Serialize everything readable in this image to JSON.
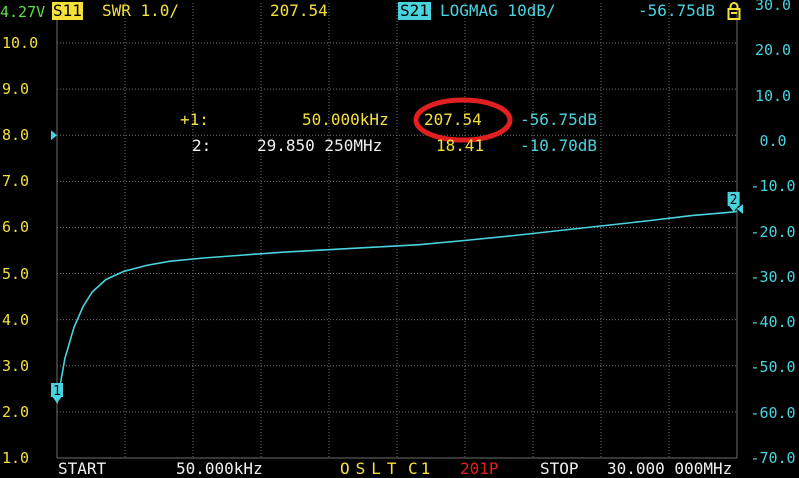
{
  "header": {
    "battery": "4.27V",
    "ch1_label": "S11",
    "ch1_format": "SWR 1.0/",
    "ch1_value": "207.54",
    "ch2_label": "S21",
    "ch2_format": "LOGMAG 10dB/",
    "ch2_value": "-56.75dB"
  },
  "markers": [
    {
      "label": "+1:",
      "freq": "50.000kHz",
      "swr": "207.54",
      "db": "-56.75dB"
    },
    {
      "label": "2:",
      "freq": "29.850 250MHz",
      "swr": "18.41",
      "db": "-10.70dB"
    }
  ],
  "footer": {
    "start_label": "START",
    "start_freq": "50.000kHz",
    "cal": "OSLT",
    "cal_slot": "C1",
    "points": "201P",
    "stop_label": "STOP",
    "stop_freq": "30.000 000MHz"
  },
  "colors": {
    "swr_axis": "#f5e03a",
    "logmag_axis": "#49d3df",
    "grid": "#6e6e6e",
    "annotation": "#e02020"
  },
  "chart_data": {
    "type": "line",
    "x_range_mhz": [
      0.05,
      30.0
    ],
    "y_left": {
      "label": "SWR",
      "range": [
        1.0,
        10.0
      ],
      "ticks": [
        "10.0",
        "9.0",
        "8.0",
        "7.0",
        "6.0",
        "5.0",
        "4.0",
        "3.0",
        "2.0",
        "1.0"
      ]
    },
    "y_right": {
      "label": "S21 LOGMAG",
      "range": [
        -70,
        30
      ],
      "ticks": [
        "30.0",
        "20.0",
        "10.0",
        "0.0",
        "-10.0",
        "-20.0",
        "-30.0",
        "-40.0",
        "-50.0",
        "-60.0",
        "-70.0"
      ]
    },
    "grid": true,
    "series": [
      {
        "axis": "right",
        "x": [
          0.05,
          0.4,
          0.8,
          1.2,
          1.6,
          2.2,
          3.0,
          4.0,
          5.0,
          6.5,
          8.0,
          10.0,
          12.0,
          14.0,
          16.0,
          18.0,
          20.0,
          22.0,
          24.0,
          26.0,
          28.0,
          29.85,
          30.0
        ],
        "y": [
          -56.75,
          -46.0,
          -38.5,
          -33.5,
          -30.0,
          -27.0,
          -25.0,
          -23.6,
          -22.6,
          -21.8,
          -21.2,
          -20.4,
          -19.8,
          -19.2,
          -18.6,
          -17.6,
          -16.5,
          -15.3,
          -14.1,
          -12.9,
          -11.6,
          -10.7,
          -10.55
        ]
      }
    ],
    "marker_points": [
      {
        "label": "1",
        "x": 0.05,
        "y": -56.75
      },
      {
        "label": "2",
        "x": 29.85,
        "y": -10.7
      }
    ],
    "reference_levels": [
      {
        "axis": "left",
        "value": 8.0
      },
      {
        "axis": "right",
        "value": -10.0
      }
    ]
  }
}
